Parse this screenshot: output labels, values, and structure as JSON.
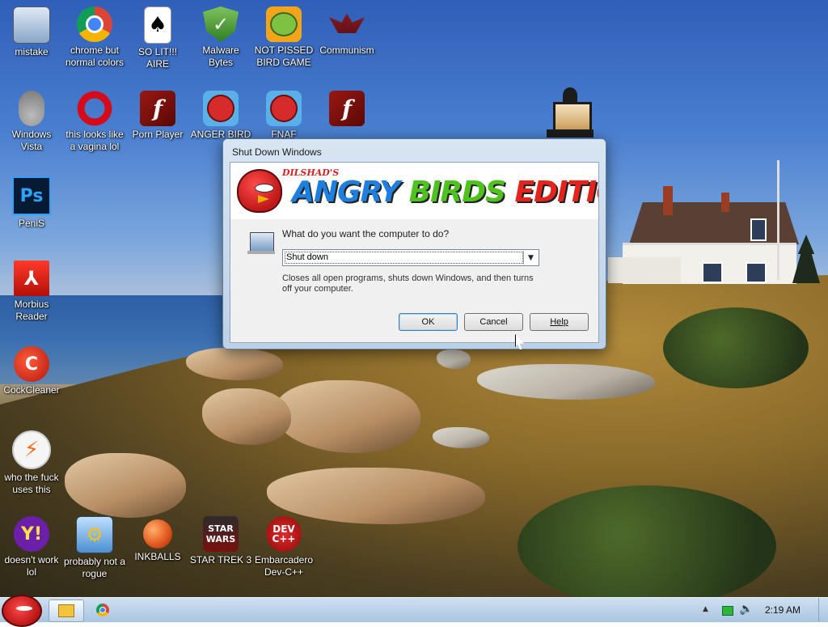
{
  "desktop": {
    "icons": [
      {
        "label": "mistake",
        "icon": "computer-icon"
      },
      {
        "label": "chrome but normal colors",
        "icon": "chrome-icon"
      },
      {
        "label": "SO LIT!!! AIRE",
        "icon": "cards-icon"
      },
      {
        "label": "Malware Bytes",
        "icon": "shield-icon"
      },
      {
        "label": "NOT PISSED BIRD GAME",
        "icon": "pig-icon"
      },
      {
        "label": "Communism",
        "icon": "emblem-icon"
      },
      {
        "label": "Windows Vista",
        "icon": "drive-icon"
      },
      {
        "label": "this looks like a vagina lol",
        "icon": "opera-icon"
      },
      {
        "label": "Porn Player",
        "icon": "flash-icon"
      },
      {
        "label": "ANGER BIRD",
        "icon": "angry-bird-icon"
      },
      {
        "label": "FNAF",
        "icon": "angry-bird-icon"
      },
      {
        "label": "",
        "icon": "flash-icon"
      },
      {
        "label": "PeniS",
        "icon": "photoshop-icon"
      },
      {
        "label": "Morbius Reader",
        "icon": "pdf-icon"
      },
      {
        "label": "CockCleaner",
        "icon": "ccleaner-icon"
      },
      {
        "label": "who the fuck uses this",
        "icon": "lightning-icon"
      },
      {
        "label": "doesn't work lol",
        "icon": "yahoo-icon"
      },
      {
        "label": "probably not a rogue",
        "icon": "gears-icon"
      },
      {
        "label": "INKBALLS",
        "icon": "ball-icon"
      },
      {
        "label": "STAR TREK 3",
        "icon": "star-wars-icon"
      },
      {
        "label": "Embarcadero Dev-C++",
        "icon": "devcpp-icon"
      }
    ],
    "glyphs": {
      "cards": "♠",
      "shield": "✓",
      "flash": "f",
      "ps": "Ps",
      "pdf": "⅄",
      "ccleaner": "C",
      "bolt": "⚡",
      "yahoo": "Y!",
      "gears": "⚙",
      "trek": "STAR WARS",
      "dev": "DEV C++"
    }
  },
  "dialog": {
    "title": "Shut Down Windows",
    "banner": {
      "small_text": "DILSHAD'S",
      "word1": "ANGRY ",
      "word2": "BIRDS ",
      "word3": "EDITION"
    },
    "question": "What do you want the computer to do?",
    "selected_option": "Shut down",
    "description": "Closes all open programs, shuts down Windows, and then turns off your computer.",
    "buttons": {
      "ok": "OK",
      "cancel": "Cancel",
      "help": "Help"
    }
  },
  "taskbar": {
    "clock": "2:19 AM",
    "tray_arrow": "▲",
    "volume_glyph": "🔈"
  }
}
